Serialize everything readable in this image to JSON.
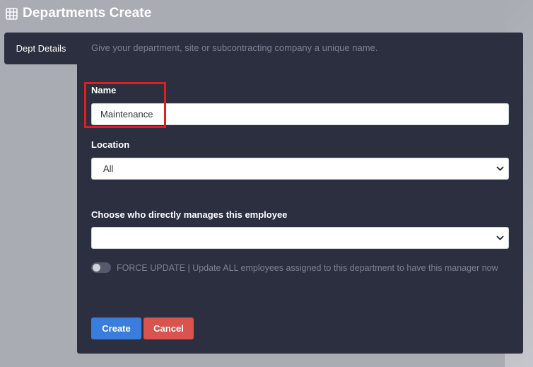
{
  "header": {
    "icon": "table-grid-icon",
    "title": "Departments Create"
  },
  "tabs": [
    {
      "label": "Dept Details",
      "active": true
    }
  ],
  "form": {
    "hint": "Give your department, site or subcontracting company a unique name.",
    "name": {
      "label": "Name",
      "value": "Maintenance"
    },
    "location": {
      "label": "Location",
      "selected": "All"
    },
    "manager": {
      "label": "Choose who directly manages this employee",
      "selected": ""
    },
    "force_update": {
      "label": "FORCE UPDATE | Update ALL employees assigned to this department to have this manager now",
      "enabled": false
    },
    "buttons": {
      "create": "Create",
      "cancel": "Cancel"
    }
  },
  "colors": {
    "panel": "#2b2f40",
    "background": "#a9acb3",
    "primary": "#3b7ddd",
    "danger": "#d9534f",
    "highlight": "#e21d1d"
  }
}
